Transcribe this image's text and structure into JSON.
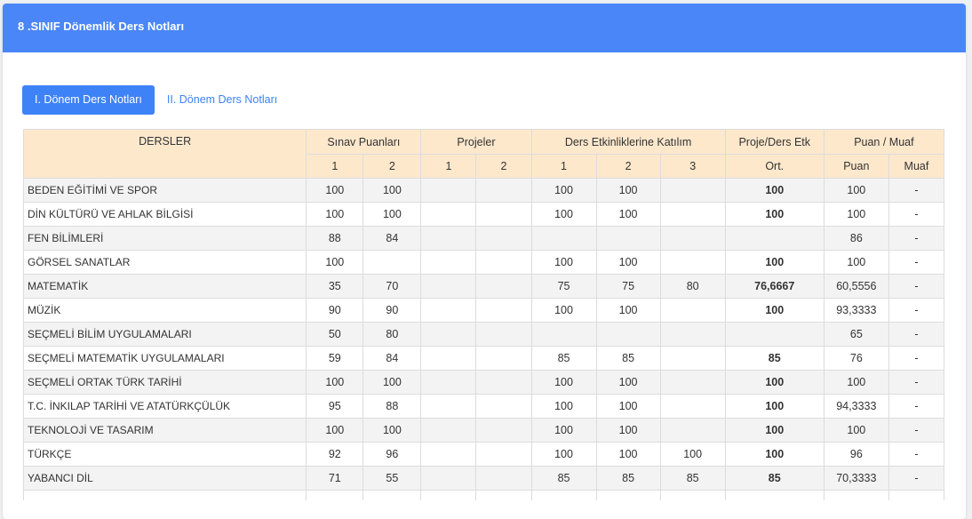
{
  "header": {
    "title": "8 .SINIF Dönemlik Ders Notları"
  },
  "tabs": [
    {
      "label": "I. Dönem Ders Notları",
      "active": true
    },
    {
      "label": "II. Dönem Ders Notları",
      "active": false
    }
  ],
  "table": {
    "group_headers": {
      "dersler": "DERSLER",
      "sinav": "Sınav Puanları",
      "projeler": "Projeler",
      "ders_etk": "Ders Etkinliklerine Katılım",
      "proje_ders_etk": "Proje/Ders Etk",
      "puan_muaf": "Puan / Muaf"
    },
    "sub_headers": {
      "sinav_1": "1",
      "sinav_2": "2",
      "proje_1": "1",
      "proje_2": "2",
      "etk_1": "1",
      "etk_2": "2",
      "etk_3": "3",
      "ort": "Ort.",
      "puan": "Puan",
      "muaf": "Muaf"
    },
    "rows": [
      {
        "ders": "BEDEN EĞİTİMİ VE SPOR",
        "s1": "100",
        "s2": "100",
        "p1": "",
        "p2": "",
        "e1": "100",
        "e2": "100",
        "e3": "",
        "ort": "100",
        "puan": "100",
        "muaf": "-"
      },
      {
        "ders": "DİN KÜLTÜRÜ VE AHLAK BİLGİSİ",
        "s1": "100",
        "s2": "100",
        "p1": "",
        "p2": "",
        "e1": "100",
        "e2": "100",
        "e3": "",
        "ort": "100",
        "puan": "100",
        "muaf": "-"
      },
      {
        "ders": "FEN BİLİMLERİ",
        "s1": "88",
        "s2": "84",
        "p1": "",
        "p2": "",
        "e1": "",
        "e2": "",
        "e3": "",
        "ort": "",
        "puan": "86",
        "muaf": "-"
      },
      {
        "ders": "GÖRSEL SANATLAR",
        "s1": "100",
        "s2": "",
        "p1": "",
        "p2": "",
        "e1": "100",
        "e2": "100",
        "e3": "",
        "ort": "100",
        "puan": "100",
        "muaf": "-"
      },
      {
        "ders": "MATEMATİK",
        "s1": "35",
        "s2": "70",
        "p1": "",
        "p2": "",
        "e1": "75",
        "e2": "75",
        "e3": "80",
        "ort": "76,6667",
        "puan": "60,5556",
        "muaf": "-"
      },
      {
        "ders": "MÜZİK",
        "s1": "90",
        "s2": "90",
        "p1": "",
        "p2": "",
        "e1": "100",
        "e2": "100",
        "e3": "",
        "ort": "100",
        "puan": "93,3333",
        "muaf": "-"
      },
      {
        "ders": "SEÇMELİ BİLİM UYGULAMALARI",
        "s1": "50",
        "s2": "80",
        "p1": "",
        "p2": "",
        "e1": "",
        "e2": "",
        "e3": "",
        "ort": "",
        "puan": "65",
        "muaf": "-"
      },
      {
        "ders": "SEÇMELİ MATEMATİK UYGULAMALARI",
        "s1": "59",
        "s2": "84",
        "p1": "",
        "p2": "",
        "e1": "85",
        "e2": "85",
        "e3": "",
        "ort": "85",
        "puan": "76",
        "muaf": "-"
      },
      {
        "ders": "SEÇMELİ ORTAK TÜRK TARİHİ",
        "s1": "100",
        "s2": "100",
        "p1": "",
        "p2": "",
        "e1": "100",
        "e2": "100",
        "e3": "",
        "ort": "100",
        "puan": "100",
        "muaf": "-"
      },
      {
        "ders": "T.C. İNKILAP TARİHİ VE ATATÜRKÇÜLÜK",
        "s1": "95",
        "s2": "88",
        "p1": "",
        "p2": "",
        "e1": "100",
        "e2": "100",
        "e3": "",
        "ort": "100",
        "puan": "94,3333",
        "muaf": "-"
      },
      {
        "ders": "TEKNOLOJİ VE TASARIM",
        "s1": "100",
        "s2": "100",
        "p1": "",
        "p2": "",
        "e1": "100",
        "e2": "100",
        "e3": "",
        "ort": "100",
        "puan": "100",
        "muaf": "-"
      },
      {
        "ders": "TÜRKÇE",
        "s1": "92",
        "s2": "96",
        "p1": "",
        "p2": "",
        "e1": "100",
        "e2": "100",
        "e3": "100",
        "ort": "100",
        "puan": "96",
        "muaf": "-"
      },
      {
        "ders": "YABANCI DİL",
        "s1": "71",
        "s2": "55",
        "p1": "",
        "p2": "",
        "e1": "85",
        "e2": "85",
        "e3": "85",
        "ort": "85",
        "puan": "70,3333",
        "muaf": "-"
      },
      {
        "ders": "",
        "s1": "",
        "s2": "",
        "p1": "",
        "p2": "",
        "e1": "",
        "e2": "",
        "e3": "",
        "ort": "",
        "puan": "",
        "muaf": ""
      }
    ]
  },
  "colors": {
    "header_bg": "#4a86f7",
    "tab_active_bg": "#3e82f7",
    "table_header_bg": "#fde8cc",
    "row_alt_bg": "#f3f3f3"
  }
}
